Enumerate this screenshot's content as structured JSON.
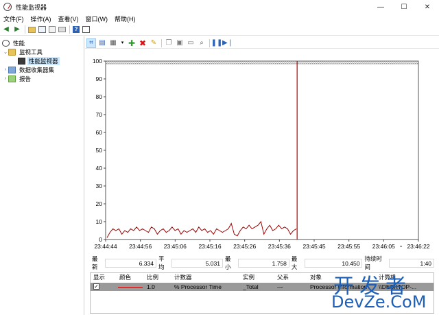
{
  "window": {
    "title": "性能监视器",
    "controls": {
      "minimize": "—",
      "maximize": "☐",
      "close": "✕"
    }
  },
  "menu": {
    "items": [
      "文件(F)",
      "操作(A)",
      "查看(V)",
      "窗口(W)",
      "帮助(H)"
    ]
  },
  "toolbar": {
    "icons": [
      "back-icon",
      "forward-icon",
      "up-folder-icon",
      "show-hide-tree-icon",
      "properties-icon",
      "export-icon",
      "help-icon",
      "console-icon"
    ]
  },
  "tree": {
    "items": [
      {
        "label": "性能",
        "icon": "performance-icon",
        "level": 0,
        "twisty": ""
      },
      {
        "label": "监视工具",
        "icon": "folder-icon",
        "level": 1,
        "twisty": "⌄"
      },
      {
        "label": "性能监视器",
        "icon": "monitor-icon",
        "level": 2,
        "twisty": "",
        "selected": true
      },
      {
        "label": "数据收集器集",
        "icon": "dataset-icon",
        "level": 1,
        "twisty": "›"
      },
      {
        "label": "报告",
        "icon": "report-icon",
        "level": 1,
        "twisty": "›"
      }
    ]
  },
  "chart_toolbar": {
    "icons": [
      "view-graph-icon",
      "view-histogram-icon",
      "change-graph-type-icon",
      "dropdown-icon",
      "add-counter-icon",
      "delete-counter-icon",
      "highlight-icon",
      "copy-properties-icon",
      "paste-counter-icon",
      "properties-icon",
      "zoom-icon",
      "freeze-display-icon",
      "update-data-icon"
    ]
  },
  "chart_data": {
    "type": "line",
    "ylim": [
      0,
      100
    ],
    "y_ticks": [
      "0",
      "10",
      "20",
      "30",
      "40",
      "50",
      "60",
      "70",
      "80",
      "90",
      "100"
    ],
    "x_ticks": [
      "23:44:44",
      "23:44:56",
      "23:45:06",
      "23:45:16",
      "23:45:26",
      "23:45:36",
      "23:45:45",
      "23:45:55",
      "23:46:05",
      "23:46:22"
    ],
    "series": [
      {
        "color": "#a00000",
        "values": [
          1,
          4,
          6,
          5,
          6,
          3,
          5,
          4,
          6,
          5,
          7,
          5,
          6,
          5,
          4,
          7,
          6,
          3,
          5,
          6,
          4,
          5,
          7,
          5,
          6,
          3,
          5,
          4,
          5,
          6,
          4,
          7,
          5,
          6,
          4,
          5,
          3,
          6,
          5,
          4,
          5,
          6,
          9,
          3,
          2,
          5,
          7,
          6,
          8,
          6,
          7,
          8,
          10,
          3,
          6,
          8,
          5,
          6,
          8,
          6,
          7,
          6,
          3,
          5,
          6
        ]
      }
    ],
    "current_position_fraction": 0.61,
    "grid": false
  },
  "stats": {
    "last_label": "最新",
    "last_value": "6.334",
    "avg_label": "平均",
    "avg_value": "5.031",
    "min_label": "最小",
    "min_value": "1.758",
    "max_label": "最大",
    "max_value": "10.450",
    "duration_label": "持续时间",
    "duration_value": "1:40"
  },
  "counter_table": {
    "headers": [
      "显示",
      "颜色",
      "比例",
      "计数器",
      "实例",
      "父系",
      "对象",
      "计算机"
    ],
    "rows": [
      {
        "show": "✓",
        "color": "#c00000",
        "scale": "1.0",
        "counter": "% Processor Time",
        "instance": "_Total",
        "parent": "---",
        "object": "Processor Information",
        "computer": "\\\\DESKTOP-..."
      }
    ]
  },
  "watermark": {
    "line1": "开发者",
    "line2": "DevZe.CoM"
  }
}
